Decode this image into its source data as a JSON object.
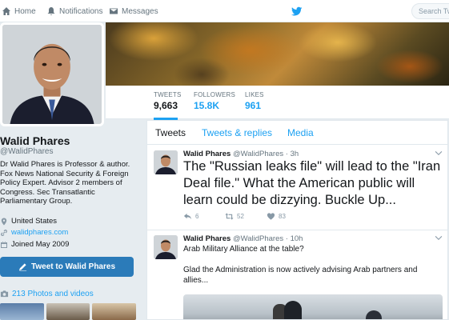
{
  "nav": {
    "home": "Home",
    "notifications": "Notifications",
    "messages": "Messages",
    "search_placeholder": "Search Twitter"
  },
  "profile": {
    "name": "Walid Phares",
    "handle": "@WalidPhares",
    "bio": "Dr Walid Phares is Professor & author. Fox News National Security & Foreign Policy Expert. Advisor 2 members of Congress. Sec Transatlantic Parliamentary Group.",
    "location": "United States",
    "website": "walidphares.com",
    "joined": "Joined May 2009",
    "tweet_to_button": "Tweet to Walid Phares",
    "photos_link": "213 Photos and videos"
  },
  "stats": {
    "tweets_label": "TWEETS",
    "tweets_value": "9,663",
    "followers_label": "FOLLOWERS",
    "followers_value": "15.8K",
    "likes_label": "LIKES",
    "likes_value": "961"
  },
  "tabs": [
    "Tweets",
    "Tweets & replies",
    "Media"
  ],
  "tweets": [
    {
      "name": "Walid Phares",
      "handle": "@WalidPhares",
      "time": "3h",
      "text": "The \"Russian leaks file\" will lead to the \"Iran Deal file.\" What the American public will learn could be dizzying. Buckle Up...",
      "replies": "6",
      "retweets": "52",
      "likes": "83"
    },
    {
      "name": "Walid Phares",
      "handle": "@WalidPhares",
      "time": "10h",
      "text_line1": "Arab Military Alliance at the table?",
      "text_line2": "Glad the Administration is now actively advising Arab partners and allies..."
    }
  ],
  "colors": {
    "accent": "#1da1f2",
    "button": "#2b7bb9",
    "background": "#e6ecf0"
  }
}
